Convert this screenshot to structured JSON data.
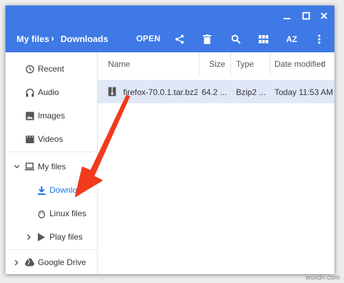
{
  "window": {
    "controls": [
      {
        "name": "minimize-button",
        "icon": "minimize-icon"
      },
      {
        "name": "maximize-button",
        "icon": "maximize-icon"
      },
      {
        "name": "close-button",
        "icon": "close-icon"
      }
    ]
  },
  "breadcrumb": {
    "root": "My files",
    "separator": "›",
    "current": "Downloads"
  },
  "toolbar": {
    "open_label": "OPEN",
    "icons": [
      "share-icon",
      "delete-icon",
      "search-icon",
      "grid-view-icon",
      "sort-az-icon",
      "more-vert-icon"
    ],
    "sort_label": "AZ",
    "color": "#3e79e6"
  },
  "sidebar": {
    "recent": "Recent",
    "audio": "Audio",
    "images": "Images",
    "videos": "Videos",
    "my_files": "My files",
    "downloads": "Downloads",
    "linux_files": "Linux files",
    "play_files": "Play files",
    "google_drive": "Google Drive",
    "selected_color": "#1a73e8"
  },
  "file_list": {
    "columns": [
      "Name",
      "Size",
      "Type",
      "Date modified"
    ],
    "sort_indicator": "↑",
    "rows": [
      {
        "name": "firefox-70.0.1.tar.bz2",
        "size": "64.2 ...",
        "type": "Bzip2 ...",
        "date": "Today 11:53 AM",
        "selected": true
      }
    ]
  },
  "annotation": {
    "arrow_color": "#f23a1c"
  },
  "watermark": "wsxdn.com"
}
